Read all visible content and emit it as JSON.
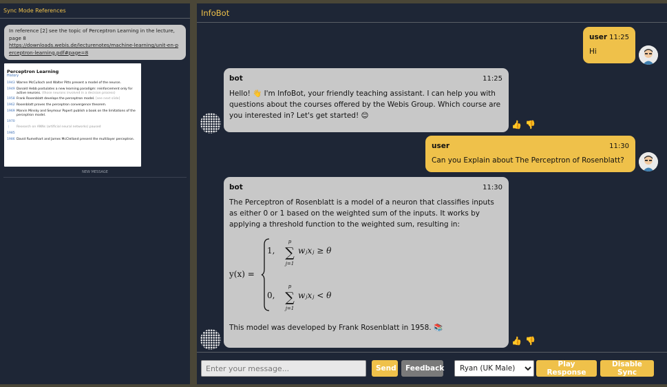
{
  "left": {
    "title": "Sync Mode References",
    "ref_text": "In reference [2] see the topic of Perceptron Learning in the lecture, page 8",
    "ref_link": "https://downloads.webis.de/lecturenotes/machine-learning/unit-en-perceptron-learning.pdf#page=8",
    "doc": {
      "title": "Perceptron Learning",
      "subtitle": "History",
      "rows": [
        {
          "year": "1943",
          "text": "Warren McCulloch and Walter Pitts present a model of the neuron.",
          "note": ""
        },
        {
          "year": "1949",
          "text": "Donald Hebb postulates a new learning paradigm: reinforcement only for active neurons.",
          "note": "(those neurons involved in a decision process)"
        },
        {
          "year": "1958",
          "text": "Frank Rosenblatt develops the perceptron model.",
          "note": "[see next slide]"
        },
        {
          "year": "1962",
          "text": "Rosenblatt proves the perceptron convergence theorem.",
          "note": ""
        },
        {
          "year": "1969",
          "text": "Marvin Minsky and Seymour Papert publish a book on the limitations of the perceptron model.",
          "note": ""
        },
        {
          "year": "1970",
          "text": "",
          "note": ""
        },
        {
          "year": "⋮",
          "text": "",
          "note": "Research on ANNs (artificial neural networks) paused"
        },
        {
          "year": "1985",
          "text": "",
          "note": ""
        },
        {
          "year": "1986",
          "text": "David Rumelhart and James McClelland present the multilayer perceptron.",
          "note": ""
        }
      ]
    },
    "new_message": "NEW MESSAGE"
  },
  "header": {
    "title": "InfoBot"
  },
  "messages": {
    "m1": {
      "who": "user",
      "time": "11:25",
      "text": "Hi"
    },
    "m2": {
      "who": "bot",
      "time": "11:25",
      "text": "Hello! 👋 I'm InfoBot, your friendly teaching assistant. I can help you with questions about the courses offered by the Webis Group. Which course are you interested in? Let's get started! 😊"
    },
    "m3": {
      "who": "user",
      "time": "11:30",
      "text": "Can you Explain about The Perceptron of Rosenblatt?"
    },
    "m4": {
      "who": "bot",
      "time": "11:30",
      "text": "The Perceptron of Rosenblatt is a model of a neuron that classifies inputs as either 0 or 1 based on the weighted sum of the inputs. It works by applying a threshold function to the weighted sum, resulting in:",
      "formula_lhs": "y(x) =",
      "case1_val": "1,",
      "case1_cond": "wⱼxⱼ ≥ θ",
      "case2_val": "0,",
      "case2_cond": "wⱼxⱼ < θ",
      "sum_top": "p",
      "sum_bottom": "j=1",
      "footer": "This model was developed by Frank Rosenblatt in 1958. 📚"
    }
  },
  "input": {
    "placeholder": "Enter your message..."
  },
  "buttons": {
    "send": "Send",
    "feedback": "Feedback",
    "voice_selected": "Ryan (UK Male)",
    "play": "Play Response",
    "sync": "Disable Sync"
  },
  "colors": {
    "accent": "#efc14a",
    "panel": "#1e2636",
    "bubble_bot": "#c8c8c8"
  }
}
